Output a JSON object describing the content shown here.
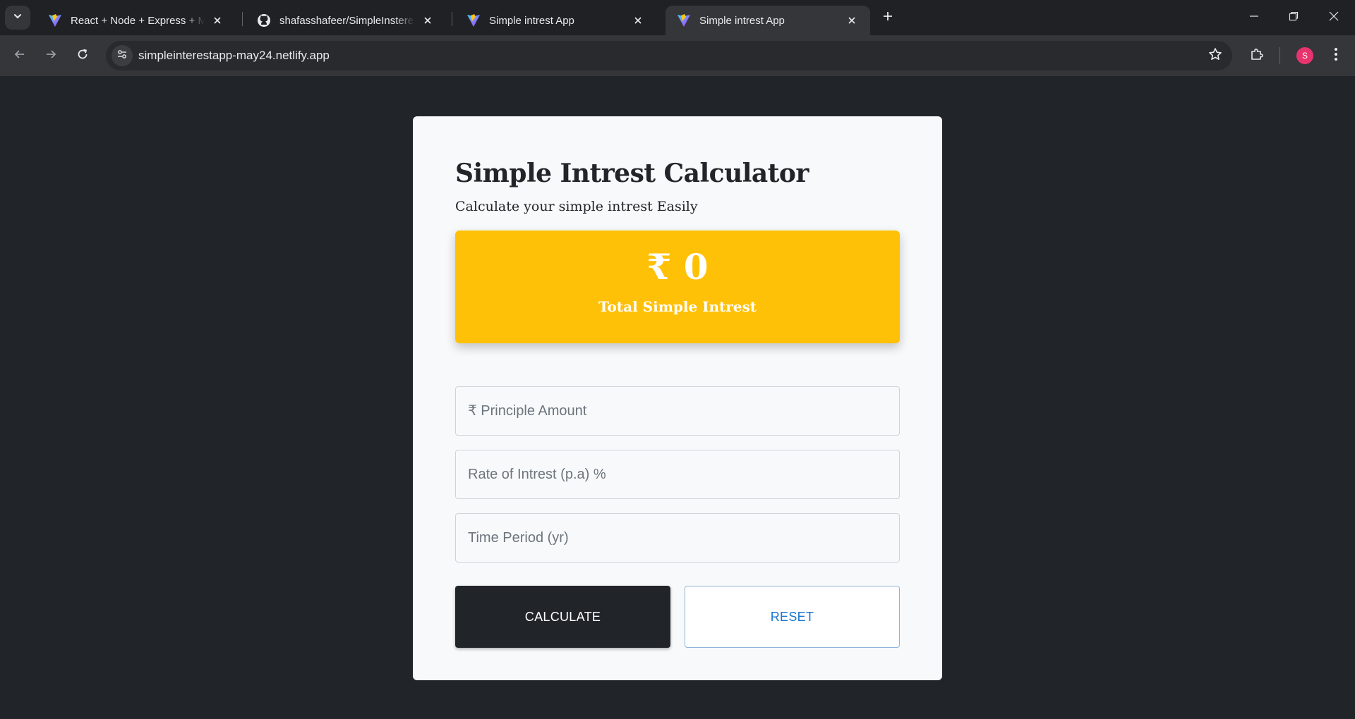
{
  "browser": {
    "tabs": [
      {
        "title": "React + Node + Express + MongoDB",
        "favicon": "vite-icon",
        "active": false
      },
      {
        "title": "shafasshafeer/SimpleInsterestApp",
        "favicon": "github-icon",
        "active": false
      },
      {
        "title": "Simple intrest App",
        "favicon": "vite-icon",
        "active": false
      },
      {
        "title": "Simple intrest App",
        "favicon": "vite-icon",
        "active": true
      }
    ],
    "url": "simpleinterestapp-may24.netlify.app",
    "profile_initial": "S"
  },
  "calculator": {
    "heading": "Simple Intrest Calculator",
    "subheading": "Calculate your simple intrest Easily",
    "result_amount": "₹ 0",
    "result_label": "Total Simple Intrest",
    "fields": {
      "principle_placeholder": "₹ Principle Amount",
      "rate_placeholder": "Rate of Intrest (p.a) %",
      "time_placeholder": "Time Period (yr)"
    },
    "buttons": {
      "calculate": "CALCULATE",
      "reset": "RESET"
    }
  },
  "colors": {
    "page_bg": "#212529",
    "card_bg": "#f8f9fa",
    "accent": "#ffc107",
    "primary_dark": "#212529",
    "reset_text": "#1976d2"
  }
}
